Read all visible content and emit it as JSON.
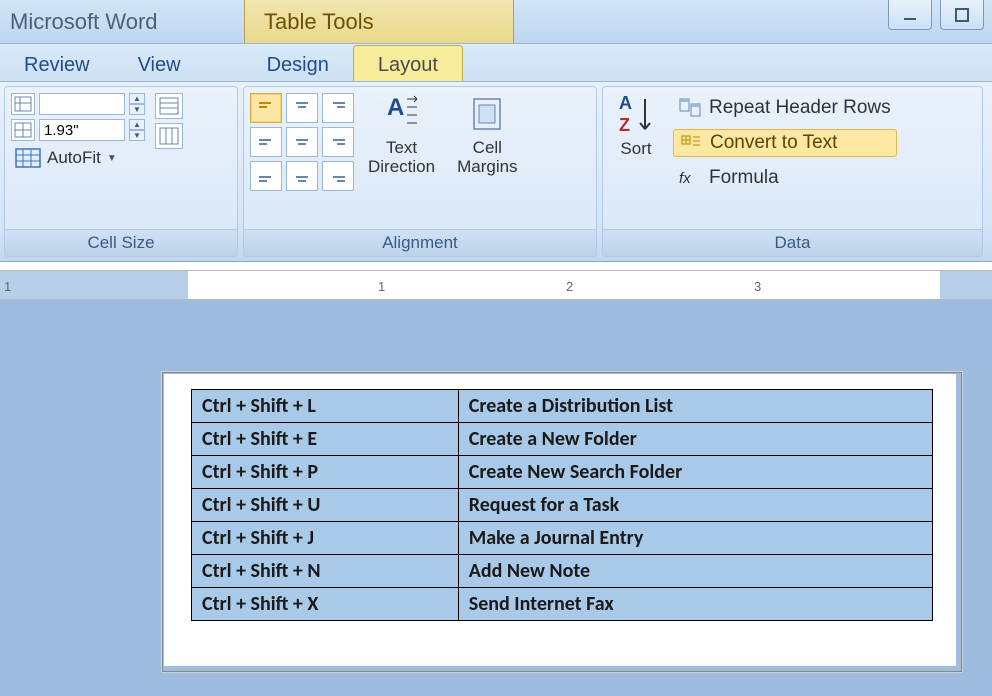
{
  "titlebar": {
    "app_title": "Microsoft Word",
    "context_title": "Table Tools"
  },
  "tabs": {
    "review": "Review",
    "view": "View",
    "design": "Design",
    "layout": "Layout"
  },
  "ribbon": {
    "cell_size": {
      "label": "Cell Size",
      "height_value": "",
      "width_value": "1.93\"",
      "autofit": "AutoFit"
    },
    "alignment": {
      "label": "Alignment",
      "text_direction": "Text Direction",
      "cell_margins": "Cell Margins"
    },
    "data": {
      "label": "Data",
      "sort": "Sort",
      "repeat_header": "Repeat Header Rows",
      "convert_to_text": "Convert to Text",
      "formula": "Formula"
    }
  },
  "ruler": {
    "marks": [
      "1",
      "1",
      "2",
      "3"
    ]
  },
  "table": {
    "rows": [
      {
        "shortcut": "Ctrl + Shift + L",
        "action": " Create a Distribution List"
      },
      {
        "shortcut": "Ctrl + Shift + E",
        "action": "Create a New Folder"
      },
      {
        "shortcut": "Ctrl + Shift + P",
        "action": "Create New Search Folder"
      },
      {
        "shortcut": "Ctrl + Shift + U",
        "action": "Request for a Task"
      },
      {
        "shortcut": "Ctrl + Shift + J",
        "action": " Make a Journal Entry"
      },
      {
        "shortcut": "Ctrl + Shift + N",
        "action": "Add New Note"
      },
      {
        "shortcut": "Ctrl + Shift + X",
        "action": "Send Internet Fax"
      }
    ]
  }
}
